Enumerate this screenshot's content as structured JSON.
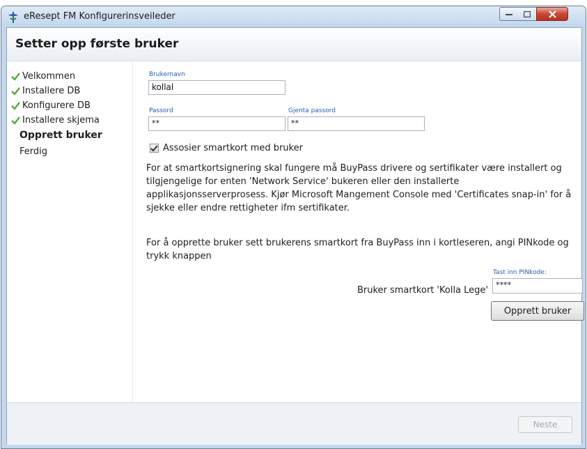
{
  "window": {
    "title": "eResept FM Konfigurerinsveileder",
    "minimize_label": "",
    "maximize_label": "",
    "close_label": ""
  },
  "header": {
    "title": "Setter opp første bruker"
  },
  "sidebar": {
    "steps": [
      {
        "label": "Velkommen",
        "status": "done"
      },
      {
        "label": "Installere DB",
        "status": "done"
      },
      {
        "label": "Konfigurere DB",
        "status": "done"
      },
      {
        "label": "Installere skjema",
        "status": "done"
      },
      {
        "label": "Opprett bruker",
        "status": "active"
      },
      {
        "label": "Ferdig",
        "status": "pending"
      }
    ]
  },
  "form": {
    "username_label": "Brukernavn",
    "username_value": "kollal",
    "password_label": "Passord",
    "password_value": "**",
    "repeat_password_label": "Gjenta passord",
    "repeat_password_value": "**",
    "smartcard_checkbox_label": "Assosier smartkort med bruker",
    "smartcard_checked": true,
    "info_paragraph_1": "For at smartkortsignering skal fungere må BuyPass drivere og sertifikater være installert og tilgjengelige for enten 'Network Service' bukeren eller den installerte applikasjonsserverprosess.  Kjør Microsoft Mangement Console med 'Certificates snap-in' for å sjekke eller endre rettigheter ifm sertifikater.",
    "info_paragraph_2": "For å opprette bruker sett brukerens smartkort fra BuyPass inn i kortleseren, angi PINkode og trykk knappen",
    "pin_label": "Tast inn PINkode:",
    "pin_value": "****",
    "card_user_label": "Bruker smartkort 'Kolla Lege'",
    "create_user_button": "Opprett bruker"
  },
  "footer": {
    "next_button": "Neste"
  },
  "colors": {
    "accent_label": "#1f5fb0",
    "check_green": "#5aa63a",
    "close_red": "#c94734"
  },
  "icons": {
    "app": "caduceus-icon",
    "step_done": "check-icon"
  }
}
